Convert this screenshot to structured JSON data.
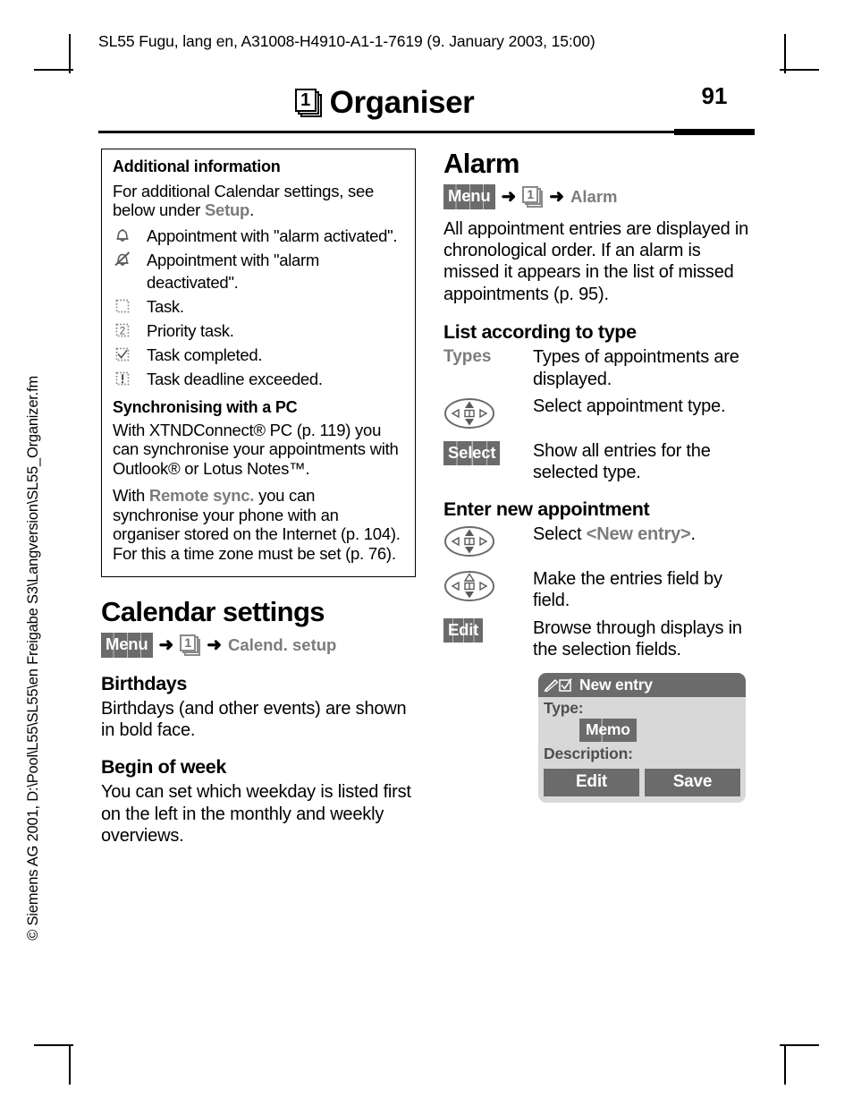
{
  "header": {
    "doc_line": "SL55 Fugu, lang en, A31008-H4910-A1-1-7619 (9. January 2003, 15:00)",
    "title": "Organiser",
    "title_icon": "pages-one-icon",
    "page_number": "91"
  },
  "footer": {
    "vertical_text": "© Siemens AG 2001, D:\\Pool\\L55\\SL55\\en Freigabe S3\\Langversion\\SL55_Organizer.fm"
  },
  "left_column": {
    "infobox": {
      "heading": "Additional information",
      "intro_prefix": "For additional Calendar settings, see below under ",
      "intro_highlight": "Setup",
      "intro_suffix": ".",
      "icon_rows": [
        {
          "icon": "bell-icon",
          "text": "Appointment with \"alarm activated\"."
        },
        {
          "icon": "bell-off-icon",
          "text": "Appointment with \"alarm deactivated\"."
        },
        {
          "icon": "task-box-icon",
          "text": "Task."
        },
        {
          "icon": "task-priority-icon",
          "label": "2",
          "text": "Priority task."
        },
        {
          "icon": "task-done-icon",
          "text": "Task completed."
        },
        {
          "icon": "task-overdue-icon",
          "label": "!",
          "text": "Task deadline exceeded."
        }
      ],
      "sync_heading": "Synchronising with a PC",
      "sync_para_1": "With XTNDConnect® PC (p. 119) you can synchronise your appointments with Outlook® or Lotus Notes™.",
      "sync_para_2_prefix": "With ",
      "sync_para_2_highlight": "Remote sync.",
      "sync_para_2_suffix": " you can synchronise your phone with an organiser stored on the Internet (p. 104). For this a time zone must be set (p. 76)."
    },
    "section": {
      "heading": "Calendar settings",
      "breadcrumb": {
        "softkey": "Menu",
        "arrow": "➜",
        "icon": "pages-one-icon",
        "target": "Calend. setup"
      },
      "subsections": [
        {
          "heading": "Birthdays",
          "body": "Birthdays (and other events) are shown in bold face."
        },
        {
          "heading": "Begin of week",
          "body": "You can set which weekday is listed first on the left in the monthly and weekly overviews."
        }
      ]
    }
  },
  "right_column": {
    "section": {
      "heading": "Alarm",
      "breadcrumb": {
        "softkey": "Menu",
        "arrow": "➜",
        "icon": "pages-one-icon",
        "target": "Alarm"
      },
      "body": "All appointment entries are displayed in chronological order. If an alarm is missed it appears in the list of missed appointments (p. 95)."
    },
    "list_by_type": {
      "heading": "List according to type",
      "rows": [
        {
          "term_type": "text",
          "term": "Types",
          "desc": "Types of appointments are displayed."
        },
        {
          "term_type": "navkey",
          "term": "nav-key-updown-icon",
          "desc": "Select appointment type."
        },
        {
          "term_type": "softkey",
          "term": "Select",
          "desc": "Show all entries for the selected type."
        }
      ]
    },
    "enter_new": {
      "heading": "Enter new appointment",
      "rows": [
        {
          "term_type": "navkey",
          "term": "nav-key-updown-icon",
          "desc_prefix": "Select ",
          "desc_highlight": "<New entry>",
          "desc_suffix": "."
        },
        {
          "term_type": "navkey-down",
          "term": "nav-key-down-icon",
          "desc": "Make the entries field by field."
        },
        {
          "term_type": "softkey",
          "term": "Edit",
          "desc": "Browse through displays in the selection fields."
        }
      ]
    },
    "phone_mockup": {
      "title_icon": "pen-checkbox-icon",
      "title": "New entry",
      "field_type_label": "Type:",
      "field_type_value": "Memo",
      "field_description_label": "Description:",
      "softkey_left": "Edit",
      "softkey_right": "Save"
    }
  },
  "colors": {
    "grey_accent": "#7c7c7c",
    "softkey_bg": "#6b6b6b",
    "phone_bg": "#d8d8d8",
    "ink": "#000000"
  }
}
